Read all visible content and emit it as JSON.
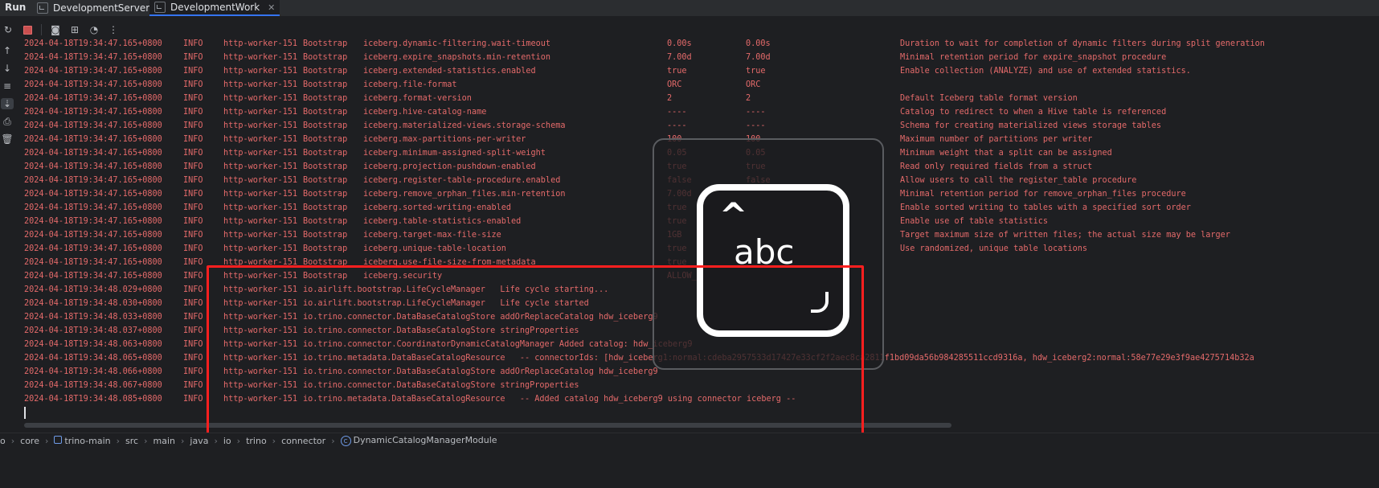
{
  "header": {
    "run_label": "Run",
    "tabs": [
      {
        "label": "DevelopmentServer",
        "active": false
      },
      {
        "label": "DevelopmentWork",
        "active": true
      }
    ]
  },
  "toolbar": {
    "icons": [
      "rerun-icon",
      "stop-icon",
      "camera-icon",
      "export-icon",
      "speed-icon",
      "more-icon"
    ]
  },
  "gutter": {
    "icons": [
      "scroll-up-icon",
      "scroll-down-icon",
      "soft-wrap-icon",
      "scroll-to-end-icon",
      "print-icon",
      "trash-icon"
    ]
  },
  "console": {
    "config_rows": [
      [
        "2024-04-18T19:34:47.165+0800",
        "INFO",
        "http-worker-151",
        "Bootstrap",
        "iceberg.dynamic-filtering.wait-timeout",
        "0.00s",
        "0.00s",
        "Duration to wait for completion of dynamic filters during split generation"
      ],
      [
        "2024-04-18T19:34:47.165+0800",
        "INFO",
        "http-worker-151",
        "Bootstrap",
        "iceberg.expire_snapshots.min-retention",
        "7.00d",
        "7.00d",
        "Minimal retention period for expire_snapshot procedure"
      ],
      [
        "2024-04-18T19:34:47.165+0800",
        "INFO",
        "http-worker-151",
        "Bootstrap",
        "iceberg.extended-statistics.enabled",
        "true",
        "true",
        "Enable collection (ANALYZE) and use of extended statistics."
      ],
      [
        "2024-04-18T19:34:47.165+0800",
        "INFO",
        "http-worker-151",
        "Bootstrap",
        "iceberg.file-format",
        "ORC",
        "ORC",
        ""
      ],
      [
        "2024-04-18T19:34:47.165+0800",
        "INFO",
        "http-worker-151",
        "Bootstrap",
        "iceberg.format-version",
        "2",
        "2",
        "Default Iceberg table format version"
      ],
      [
        "2024-04-18T19:34:47.165+0800",
        "INFO",
        "http-worker-151",
        "Bootstrap",
        "iceberg.hive-catalog-name",
        "----",
        "----",
        "Catalog to redirect to when a Hive table is referenced"
      ],
      [
        "2024-04-18T19:34:47.165+0800",
        "INFO",
        "http-worker-151",
        "Bootstrap",
        "iceberg.materialized-views.storage-schema",
        "----",
        "----",
        "Schema for creating materialized views storage tables"
      ],
      [
        "2024-04-18T19:34:47.165+0800",
        "INFO",
        "http-worker-151",
        "Bootstrap",
        "iceberg.max-partitions-per-writer",
        "100",
        "100",
        "Maximum number of partitions per writer"
      ],
      [
        "2024-04-18T19:34:47.165+0800",
        "INFO",
        "http-worker-151",
        "Bootstrap",
        "iceberg.minimum-assigned-split-weight",
        "0.05",
        "0.05",
        "Minimum weight that a split can be assigned"
      ],
      [
        "2024-04-18T19:34:47.165+0800",
        "INFO",
        "http-worker-151",
        "Bootstrap",
        "iceberg.projection-pushdown-enabled",
        "true",
        "true",
        "Read only required fields from a struct"
      ],
      [
        "2024-04-18T19:34:47.165+0800",
        "INFO",
        "http-worker-151",
        "Bootstrap",
        "iceberg.register-table-procedure.enabled",
        "false",
        "false",
        "Allow users to call the register_table procedure"
      ],
      [
        "2024-04-18T19:34:47.165+0800",
        "INFO",
        "http-worker-151",
        "Bootstrap",
        "iceberg.remove_orphan_files.min-retention",
        "7.00d",
        "7.00d",
        "Minimal retention period for remove_orphan_files procedure"
      ],
      [
        "2024-04-18T19:34:47.165+0800",
        "INFO",
        "http-worker-151",
        "Bootstrap",
        "iceberg.sorted-writing-enabled",
        "true",
        "true",
        "Enable sorted writing to tables with a specified sort order"
      ],
      [
        "2024-04-18T19:34:47.165+0800",
        "INFO",
        "http-worker-151",
        "Bootstrap",
        "iceberg.table-statistics-enabled",
        "true",
        "true",
        "Enable use of table statistics"
      ],
      [
        "2024-04-18T19:34:47.165+0800",
        "INFO",
        "http-worker-151",
        "Bootstrap",
        "iceberg.target-max-file-size",
        "1GB",
        "1GB",
        "Target maximum size of written files; the actual size may be larger"
      ],
      [
        "2024-04-18T19:34:47.165+0800",
        "INFO",
        "http-worker-151",
        "Bootstrap",
        "iceberg.unique-table-location",
        "true",
        "true",
        "Use randomized, unique table locations"
      ],
      [
        "2024-04-18T19:34:47.165+0800",
        "INFO",
        "http-worker-151",
        "Bootstrap",
        "iceberg.use-file-size-from-metadata",
        "true",
        "true",
        ""
      ],
      [
        "2024-04-18T19:34:47.165+0800",
        "INFO",
        "http-worker-151",
        "Bootstrap",
        "iceberg.security",
        "ALLOW_ALL",
        "ALLOW_ALL",
        ""
      ]
    ],
    "message_rows": [
      [
        "2024-04-18T19:34:48.029+0800",
        "INFO",
        "http-worker-151",
        "io.airlift.bootstrap.LifeCycleManager   Life cycle starting..."
      ],
      [
        "2024-04-18T19:34:48.030+0800",
        "INFO",
        "http-worker-151",
        "io.airlift.bootstrap.LifeCycleManager   Life cycle started"
      ],
      [
        "2024-04-18T19:34:48.033+0800",
        "INFO",
        "http-worker-151",
        "io.trino.connector.DataBaseCatalogStore addOrReplaceCatalog hdw_iceberg9"
      ],
      [
        "2024-04-18T19:34:48.037+0800",
        "INFO",
        "http-worker-151",
        "io.trino.connector.DataBaseCatalogStore stringProperties"
      ],
      [
        "2024-04-18T19:34:48.063+0800",
        "INFO",
        "http-worker-151",
        "io.trino.connector.CoordinatorDynamicCatalogManager Added catalog: hdw_iceberg9"
      ],
      [
        "2024-04-18T19:34:48.065+0800",
        "INFO",
        "http-worker-151",
        "io.trino.metadata.DataBaseCatalogResource   -- connectorIds: [hdw_iceberg1:normal:cdeba2957533d17427e33cf2f2aec8ca2811f1bd09da56b984285511ccd9316a, hdw_iceberg2:normal:58e77e29e3f9ae4275714b32a"
      ],
      [
        "2024-04-18T19:34:48.066+0800",
        "INFO",
        "http-worker-151",
        "io.trino.connector.DataBaseCatalogStore addOrReplaceCatalog hdw_iceberg9"
      ],
      [
        "2024-04-18T19:34:48.067+0800",
        "INFO",
        "http-worker-151",
        "io.trino.connector.DataBaseCatalogStore stringProperties"
      ],
      [
        "2024-04-18T19:34:48.085+0800",
        "INFO",
        "http-worker-151",
        "io.trino.metadata.DataBaseCatalogResource   -- Added catalog hdw_iceberg9 using connector iceberg --"
      ]
    ]
  },
  "overlay": {
    "caret": "^",
    "text": "abc"
  },
  "breadcrumb": {
    "items": [
      "o",
      "core",
      "trino-main",
      "src",
      "main",
      "java",
      "io",
      "trino",
      "connector",
      "DynamicCatalogManagerModule"
    ]
  },
  "colors": {
    "log_text": "#e46a6a",
    "highlight_box": "#ff1f1f",
    "accent": "#3574f0"
  }
}
